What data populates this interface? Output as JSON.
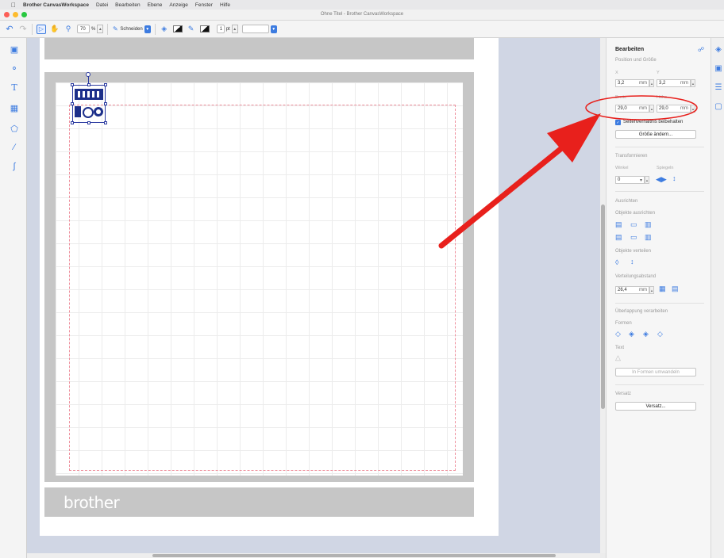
{
  "menubar": {
    "app_name": "Brother CanvasWorkspace",
    "items": [
      "Datei",
      "Bearbeiten",
      "Ebene",
      "Anzeige",
      "Fenster",
      "Hilfe"
    ]
  },
  "window": {
    "title": "Ohne Titel - Brother CanvasWorkspace"
  },
  "toolbar": {
    "zoom_value": "70",
    "zoom_unit": "%",
    "mode_label": "Schneiden",
    "line_width": "1",
    "line_unit": "pt"
  },
  "canvas": {
    "brand": "brother"
  },
  "panel": {
    "title": "Bearbeiten",
    "position_section": "Position und Größe",
    "x_label": "X",
    "y_label": "Y",
    "x_value": "3,2",
    "y_value": "3,2",
    "unit": "mm",
    "width_label": "Breite",
    "height_label": "Höhe",
    "width_value": "29,0",
    "height_value": "29,0",
    "keep_ratio_label": "Seitenverhältnis beibehalten",
    "resize_button": "Größe ändern...",
    "transform_section": "Transformieren",
    "angle_label": "Winkel",
    "mirror_label": "Spiegeln",
    "angle_value": "0",
    "align_section": "Ausrichten",
    "align_objects_label": "Objekte ausrichten",
    "distribute_label": "Objekte verteilen",
    "spacing_label": "Verteilungsabstand",
    "spacing_value": "26,4",
    "overlap_section": "Überlappung verarbeiten",
    "shapes_label": "Formen",
    "text_label": "Text",
    "to_shapes_button": "In Formen umwandeln",
    "offset_section": "Versatz",
    "offset_button": "Versatz..."
  },
  "colors": {
    "accent": "#3c7be0",
    "annotation": "#e8201c",
    "object": "#1c2f8a"
  }
}
